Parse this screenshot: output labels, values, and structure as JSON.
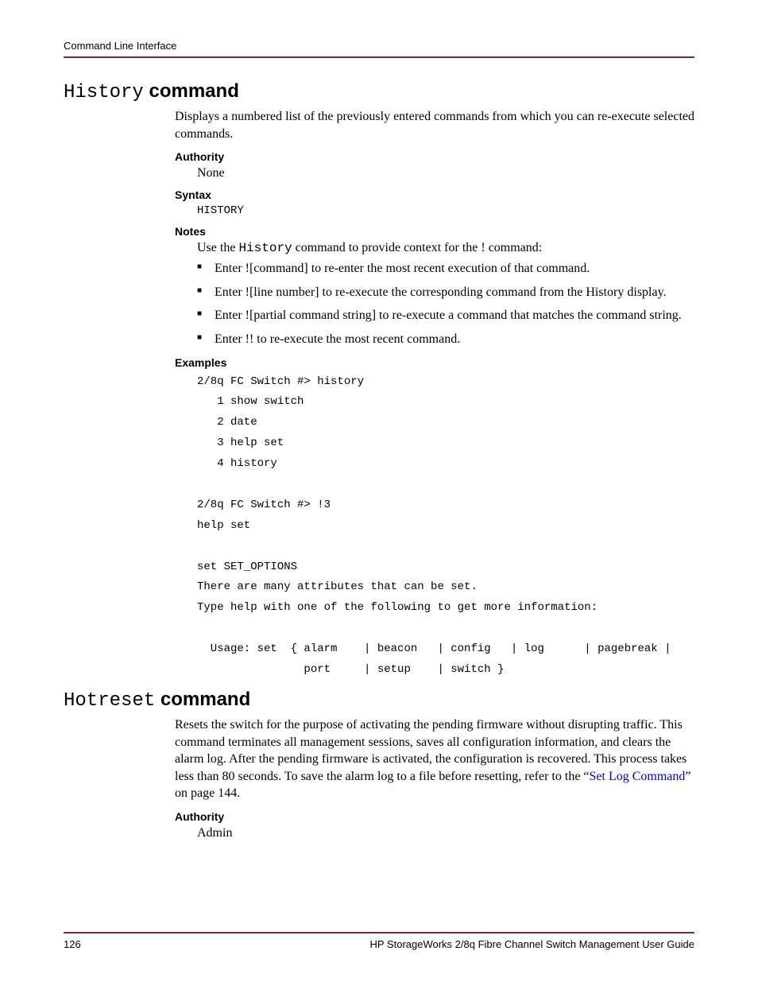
{
  "header": {
    "running_head": "Command Line Interface"
  },
  "section1": {
    "title_mono": "History",
    "title_bold": " command",
    "description": "Displays a numbered list of the previously entered commands from which you can re-execute selected commands.",
    "authority": {
      "label": "Authority",
      "value": "None"
    },
    "syntax": {
      "label": "Syntax",
      "value": "HISTORY"
    },
    "notes": {
      "label": "Notes",
      "intro_pre": "Use the ",
      "intro_mono": "History",
      "intro_post": " command to provide context for the ! command:",
      "items": [
        "Enter ![command] to re-enter the most recent execution of that command.",
        "Enter ![line number] to re-execute the corresponding command from the History display.",
        "Enter ![partial command string] to re-execute a command that matches the command string.",
        "Enter !! to re-execute the most recent command."
      ]
    },
    "examples": {
      "label": "Examples",
      "text": "2/8q FC Switch #> history\n   1 show switch\n   2 date\n   3 help set\n   4 history\n\n2/8q FC Switch #> !3\nhelp set\n\nset SET_OPTIONS\nThere are many attributes that can be set.\nType help with one of the following to get more information:\n\n  Usage: set  { alarm    | beacon   | config   | log      | pagebreak |\n                port     | setup    | switch }"
    }
  },
  "section2": {
    "title_mono": "Hotreset",
    "title_bold": " command",
    "desc_pre": "Resets the switch for the purpose of activating the pending firmware without disrupting traffic. This command terminates all management sessions, saves all configuration information, and clears the alarm log. After the pending firmware is activated, the configuration is recovered. This process takes less than 80 seconds. To save the alarm log to a file before resetting, refer to the “",
    "desc_link": "Set Log Command",
    "desc_post": "” on page 144.",
    "authority": {
      "label": "Authority",
      "value": "Admin"
    }
  },
  "footer": {
    "page_number": "126",
    "doc_title": "HP StorageWorks 2/8q Fibre Channel Switch Management User Guide"
  }
}
